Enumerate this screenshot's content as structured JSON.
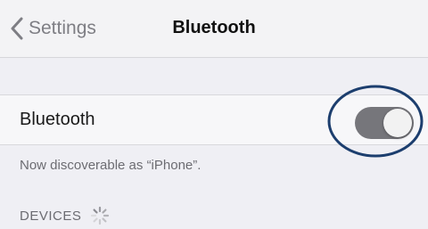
{
  "navbar": {
    "back_label": "Settings",
    "title": "Bluetooth",
    "back_icon": "chevron-left-icon"
  },
  "bluetooth_row": {
    "label": "Bluetooth",
    "toggle_state": "off"
  },
  "footer": {
    "discoverable_text": "Now discoverable as “iPhone”."
  },
  "devices": {
    "header": "DEVICES",
    "icon": "loading-spinner-icon"
  },
  "annotation": {
    "type": "circle-highlight",
    "color": "#1c3e6e"
  },
  "colors": {
    "background": "#efeff4",
    "toggle_track": "#76767b"
  }
}
